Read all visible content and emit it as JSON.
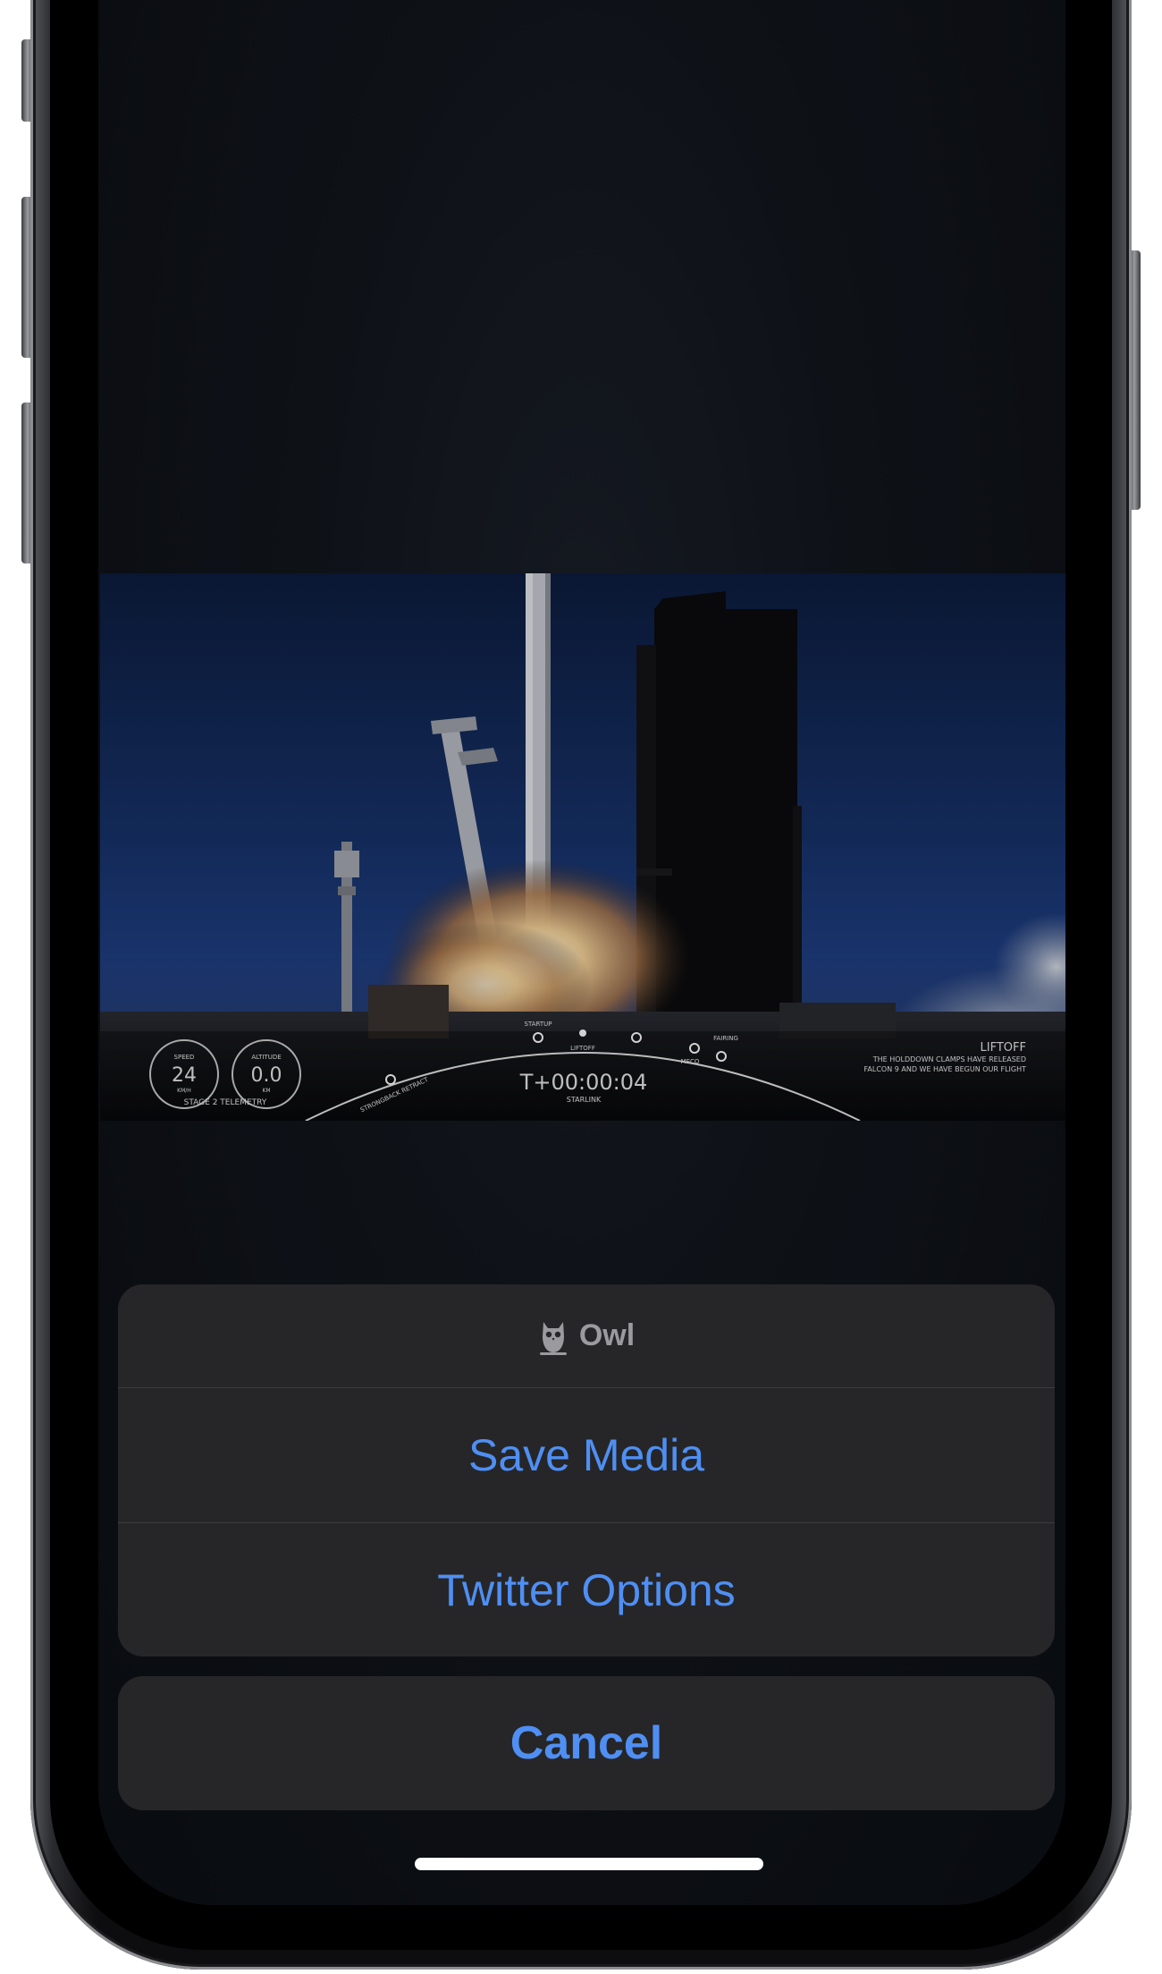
{
  "app": {
    "name": "Owl"
  },
  "video": {
    "hud": {
      "speed_label": "SPEED",
      "speed_value": "24",
      "speed_unit": "KM/H",
      "altitude_label": "ALTITUDE",
      "altitude_value": "0.0",
      "altitude_unit": "KM",
      "stage_label": "STAGE 2 TELEMETRY",
      "timer": "T+00:00:04",
      "mission": "STARLINK",
      "event_title": "LIFTOFF",
      "event_line1": "THE HOLDDOWN CLAMPS HAVE RELEASED",
      "event_line2": "FALCON 9 AND WE HAVE BEGUN OUR FLIGHT",
      "milestones": [
        "STRONGBACK RETRACT",
        "STARTUP",
        "LIFTOFF",
        "MECO",
        "FAIRING"
      ]
    }
  },
  "action_sheet": {
    "title": "Owl",
    "actions": [
      {
        "label": "Save Media"
      },
      {
        "label": "Twitter Options"
      }
    ],
    "cancel_label": "Cancel"
  },
  "colors": {
    "accent": "#4f8ff3",
    "sheet_bg": "#262628",
    "screen_bg": "#12161d"
  },
  "icons": {
    "header": "owl-icon"
  }
}
